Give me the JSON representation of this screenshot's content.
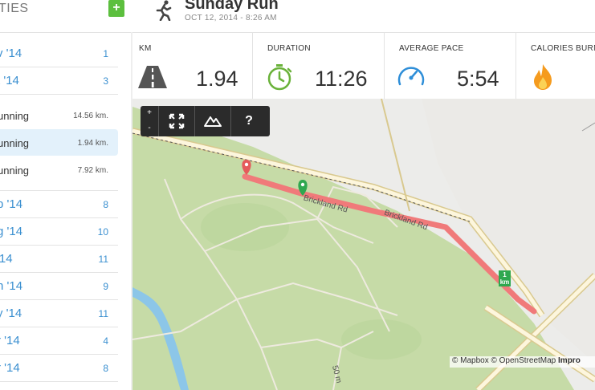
{
  "sidebar": {
    "title": "TIES",
    "add_label": "+",
    "months_top": [
      {
        "label": "v '14",
        "count": "1"
      },
      {
        "label": "t '14",
        "count": "3"
      }
    ],
    "activities": [
      {
        "label": "unning",
        "distance": "14.56 km."
      },
      {
        "label": "unning",
        "distance": "1.94 km."
      },
      {
        "label": "unning",
        "distance": "7.92 km."
      }
    ],
    "months": [
      {
        "label": "p '14",
        "count": "8"
      },
      {
        "label": "g '14",
        "count": "10"
      },
      {
        "label": " '14",
        "count": "11"
      },
      {
        "label": "n '14",
        "count": "9"
      },
      {
        "label": "y '14",
        "count": "11"
      },
      {
        "label": "r '14",
        "count": "4"
      },
      {
        "label": "r '14",
        "count": "8"
      }
    ]
  },
  "header": {
    "title": "Sunday Run",
    "date": "OCT 12, 2014  -  8:26 AM"
  },
  "stats": {
    "km_label": "KM",
    "km_value": "1.94",
    "duration_label": "DURATION",
    "duration_value": "11:26",
    "pace_label": "AVERAGE PACE",
    "pace_value": "5:54",
    "calories_label": "CALORIES BURNED"
  },
  "map": {
    "zoom_in": "+",
    "zoom_out": "-",
    "help": "?",
    "road_label_1": "Brickland Rd",
    "road_label_2": "Brickland Rd",
    "road_label_3": "50 m",
    "km_marker_number": "1",
    "km_marker_unit": "km",
    "attribution_1": "© Mapbox © OpenStreetMap ",
    "attribution_2": "Impro",
    "colors": {
      "park": "#c6dba7",
      "route": "#f07a7a",
      "start_pin": "#2fa84f",
      "end_pin": "#e55b5b",
      "water": "#8cc6e8"
    }
  },
  "icons": {
    "runner": "runner-icon",
    "road": "road-icon",
    "stopwatch": "stopwatch-icon",
    "gauge": "gauge-icon",
    "flame": "flame-icon",
    "fullscreen": "fullscreen-icon",
    "terrain": "terrain-icon"
  }
}
